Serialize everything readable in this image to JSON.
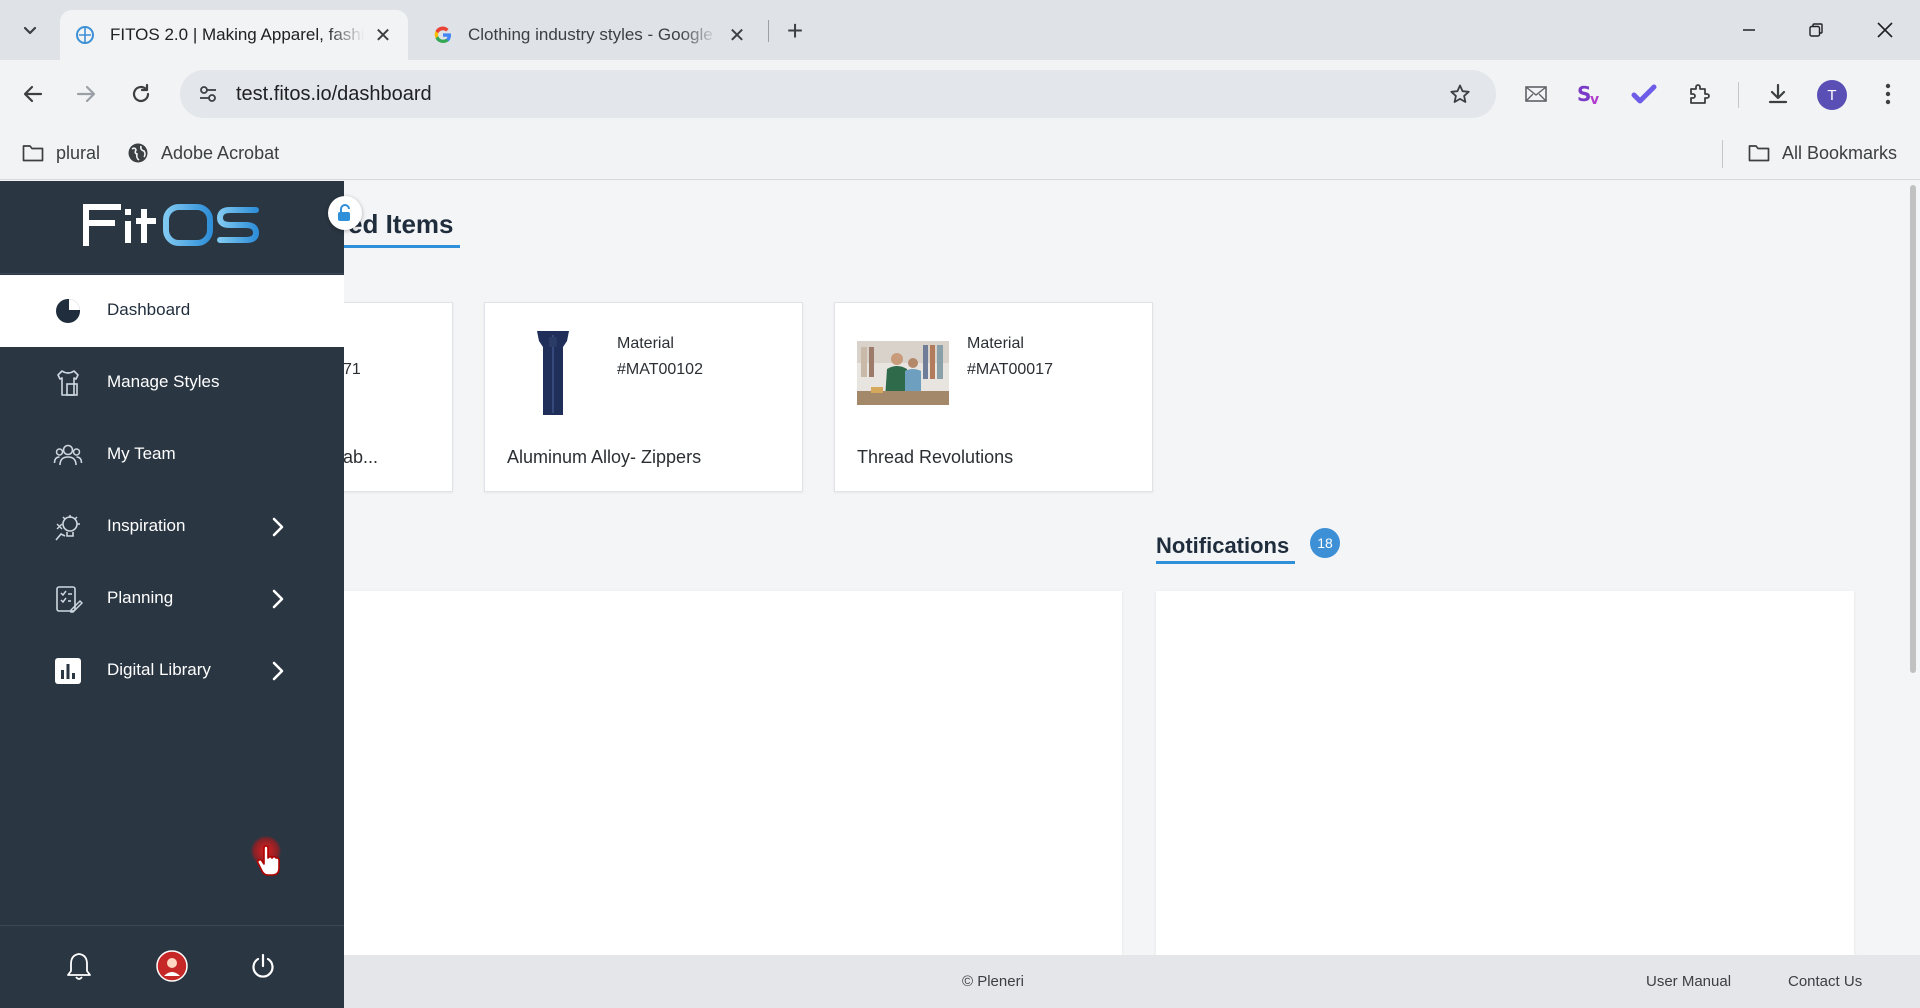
{
  "browser": {
    "tabs": [
      {
        "title": "FITOS 2.0 | Making Apparel, fashion",
        "active": true,
        "favicon": "fitos-icon"
      },
      {
        "title": "Clothing industry styles - Google Search",
        "active": false,
        "favicon": "google-icon"
      }
    ],
    "url": "test.fitos.io/dashboard",
    "profile_initial": "T",
    "bookmarks": [
      {
        "label": "plural",
        "icon": "folder-icon"
      },
      {
        "label": "Adobe Acrobat",
        "icon": "globe-icon"
      }
    ],
    "all_bookmarks_label": "All Bookmarks"
  },
  "sidebar": {
    "logo_text": "FitOS",
    "items": [
      {
        "label": "Dashboard",
        "icon": "dashboard-pie-icon",
        "active": true,
        "has_children": false
      },
      {
        "label": "Manage Styles",
        "icon": "styles-icon",
        "active": false,
        "has_children": false
      },
      {
        "label": "My Team",
        "icon": "team-icon",
        "active": false,
        "has_children": false
      },
      {
        "label": "Inspiration",
        "icon": "inspiration-icon",
        "active": false,
        "has_children": true
      },
      {
        "label": "Planning",
        "icon": "planning-icon",
        "active": false,
        "has_children": true
      },
      {
        "label": "Digital Library",
        "icon": "bar-chart-icon",
        "active": false,
        "has_children": true
      }
    ]
  },
  "main": {
    "featured_title": "ed Items",
    "cards": [
      {
        "category": "",
        "code": "71",
        "name": "ab..."
      },
      {
        "category": "Material",
        "code": "#MAT00102",
        "name": "Aluminum Alloy- Zippers"
      },
      {
        "category": "Material",
        "code": "#MAT00017",
        "name": "Thread Revolutions"
      }
    ],
    "notifications": {
      "title": "Notifications",
      "count": "18"
    }
  },
  "footer": {
    "copyright": "© Pleneri",
    "links": [
      "User Manual",
      "Contact Us"
    ]
  },
  "colors": {
    "sidebar_bg": "#2a3642",
    "accent": "#2f8fd8",
    "badge": "#3d8fd6"
  }
}
